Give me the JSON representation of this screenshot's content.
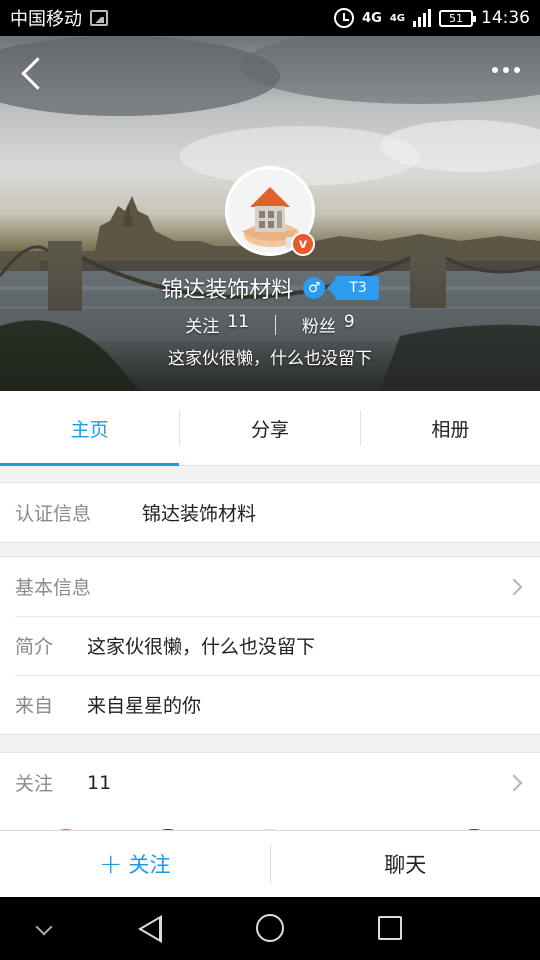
{
  "status_bar": {
    "carrier": "中国移动",
    "network_1": "4G",
    "network_2": "4G",
    "battery": "51",
    "time": "14:36",
    "icons": [
      "image-icon",
      "alarm-icon",
      "signal-icon",
      "battery-icon"
    ]
  },
  "profile": {
    "name": "锦达装饰材料",
    "verified_badge": "v",
    "gender_icon": "♂",
    "level": "T3",
    "following_label": "关注",
    "following_count": "11",
    "followers_label": "粉丝",
    "followers_count": "9",
    "bio": "这家伙很懒，什么也没留下"
  },
  "tabs": [
    {
      "label": "主页",
      "active": true
    },
    {
      "label": "分享",
      "active": false
    },
    {
      "label": "相册",
      "active": false
    }
  ],
  "auth": {
    "label": "认证信息",
    "value": "锦达装饰材料"
  },
  "basic": {
    "header": "基本信息",
    "intro_label": "简介",
    "intro_value": "这家伙很懒，什么也没留下",
    "from_label": "来自",
    "from_value": "来自星星的你"
  },
  "follow_section": {
    "label": "关注",
    "value": "11"
  },
  "actions": {
    "follow_icon": "+",
    "follow_label": "关注",
    "chat_label": "聊天"
  },
  "colors": {
    "accent": "#1a9be6",
    "verified": "#e85a2c",
    "gender": "#2b9cf0"
  }
}
